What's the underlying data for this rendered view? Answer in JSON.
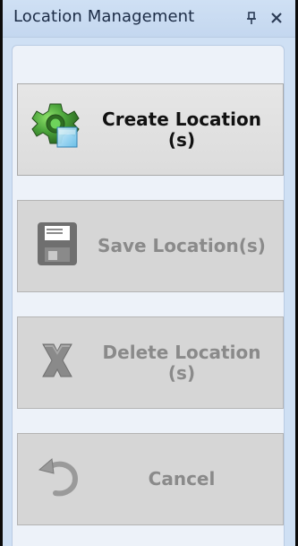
{
  "panel": {
    "title": "Location Management",
    "icons": {
      "pin": "pin-icon",
      "close": "close-icon"
    },
    "colors": {
      "titlebar_bg": "#cfe0f4",
      "content_bg": "#edf2f9",
      "enabled_button_bg": "#e0e0e0",
      "disabled_button_bg": "#d6d6d6",
      "disabled_text": "#8a8a8a"
    }
  },
  "buttons": [
    {
      "label": "Create Location (s)",
      "icon": "gear-add-icon",
      "enabled": true
    },
    {
      "label": "Save Location(s)",
      "icon": "save-icon",
      "enabled": false
    },
    {
      "label": "Delete Location (s)",
      "icon": "delete-x-icon",
      "enabled": false
    },
    {
      "label": "Cancel",
      "icon": "undo-arrow-icon",
      "enabled": false
    }
  ]
}
